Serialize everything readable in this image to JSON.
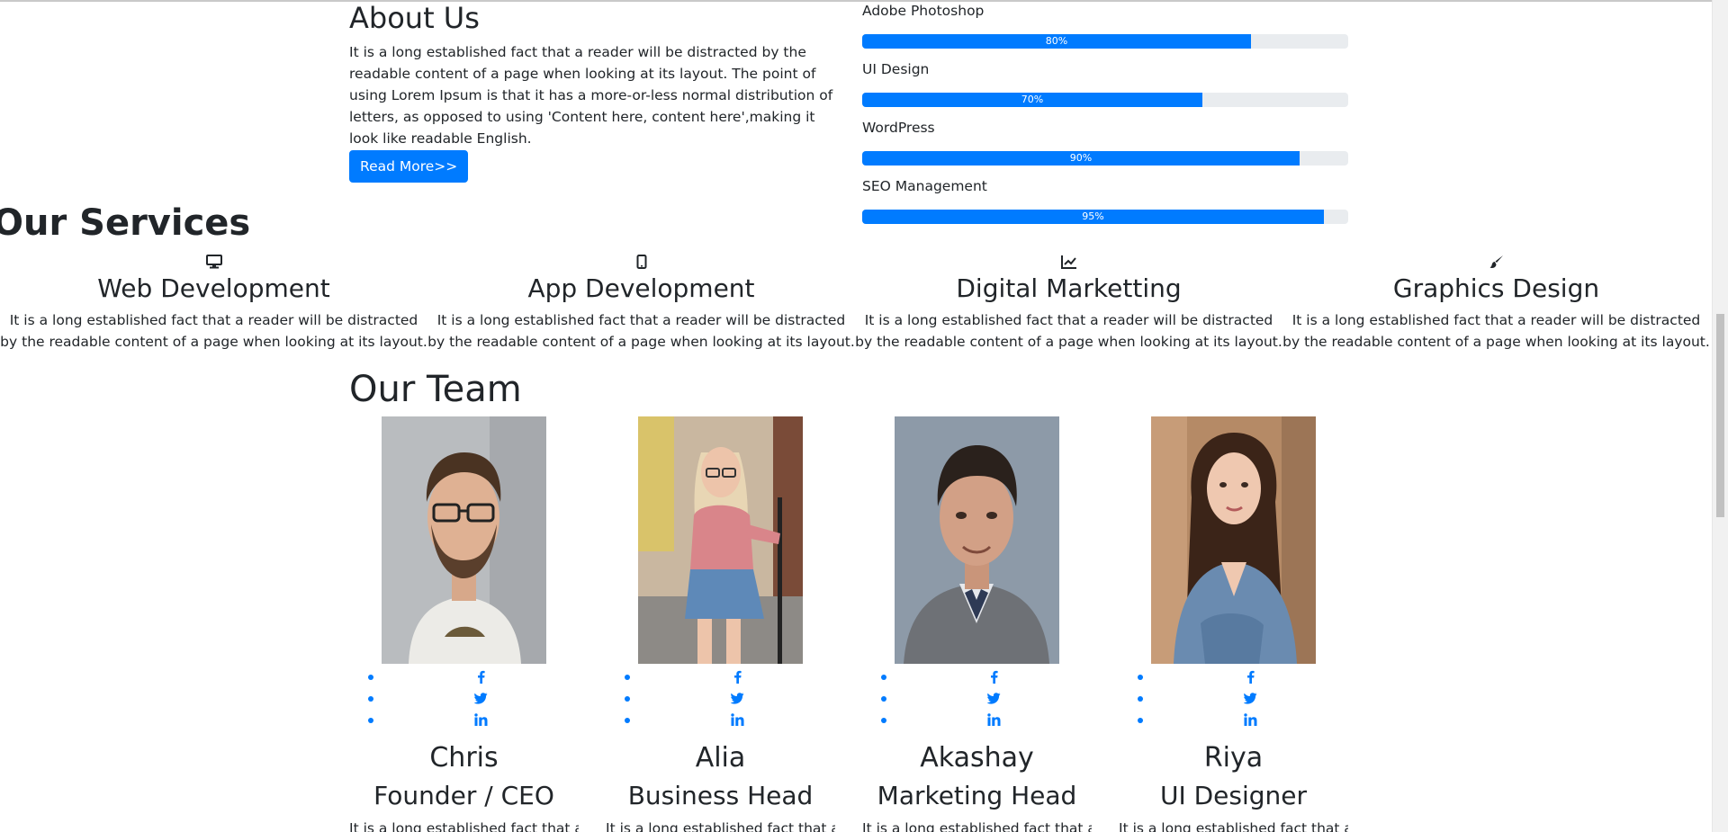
{
  "about": {
    "title": "About Us",
    "text": "It is a long established fact that a reader will be distracted by the readable content of a page when looking at its layout. The point of using Lorem Ipsum is that it has a more-or-less normal distribution of letters, as opposed to using 'Content here, content here',making it look like readable English.",
    "button_label": "Read More>>"
  },
  "skills": [
    {
      "label": "Adobe Photoshop",
      "percent": 80,
      "percent_label": "80%"
    },
    {
      "label": "UI Design",
      "percent": 70,
      "percent_label": "70%"
    },
    {
      "label": "WordPress",
      "percent": 90,
      "percent_label": "90%"
    },
    {
      "label": "SEO Management",
      "percent": 95,
      "percent_label": "95%"
    }
  ],
  "services": {
    "title": "Our Services",
    "items": [
      {
        "icon": "desktop-icon",
        "title": "Web Development",
        "text": "It is a long established fact that a reader will be distracted by the readable content of a page when looking at its layout."
      },
      {
        "icon": "mobile-icon",
        "title": "App Development",
        "text": "It is a long established fact that a reader will be distracted by the readable content of a page when looking at its layout."
      },
      {
        "icon": "chart-line-icon",
        "title": "Digital Marketting",
        "text": "It is a long established fact that a reader will be distracted by the readable content of a page when looking at its layout."
      },
      {
        "icon": "paint-brush-icon",
        "title": "Graphics Design",
        "text": "It is a long established fact that a reader will be distracted by the readable content of a page when looking at its layout."
      }
    ]
  },
  "team": {
    "title": "Our Team",
    "members": [
      {
        "name": "Chris",
        "role": "Founder / CEO",
        "text": "It is a long established fact that a reader"
      },
      {
        "name": "Alia",
        "role": "Business Head",
        "text": "It is a long established fact that a reader"
      },
      {
        "name": "Akashay",
        "role": "Marketing Head",
        "text": "It is a long established fact that a reader"
      },
      {
        "name": "Riya",
        "role": "UI Designer",
        "text": "It is a long established fact that a reader"
      }
    ],
    "social_icons": [
      "facebook-icon",
      "twitter-icon",
      "linkedin-icon"
    ]
  },
  "colors": {
    "primary": "#007bff",
    "track": "#e9ecef",
    "text": "#212529"
  }
}
